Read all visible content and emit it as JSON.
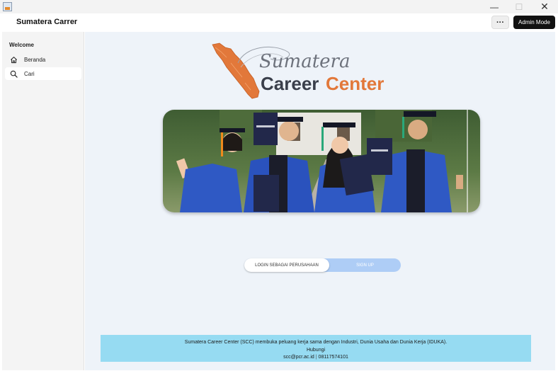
{
  "window": {
    "minimize_glyph": "—",
    "maximize_glyph": "☐",
    "close_glyph": "✕"
  },
  "header": {
    "title": "Sumatera Carrer",
    "more_label": "···",
    "admin_label": "Admin Mode"
  },
  "sidebar": {
    "heading": "Welcome",
    "items": [
      {
        "label": "Beranda",
        "icon": "home-icon",
        "active": false
      },
      {
        "label": "Cari",
        "icon": "search-icon",
        "active": true
      }
    ]
  },
  "logo": {
    "script_text": "Sumatera",
    "word_career": "Career",
    "word_center": "Center",
    "career_color": "#3a3f4b",
    "center_color": "#e2783a",
    "map_color": "#e2783a"
  },
  "auth_toggle": {
    "login_label": "LOGIN SEBAGAI PERUSAHAAN",
    "signup_label": "SIGN UP",
    "selected": "login"
  },
  "footer": {
    "description": "Sumatera Career Center (SCC) membuka peluang kerja sama dengan Industri, Dunia Usaha dan Dunia Kerja (IDUKA).",
    "contact_heading": "Hubungi",
    "email": "scc@pcr.ac.id",
    "separator": "|",
    "phone": "08117574101",
    "background": "#96dbf2"
  },
  "colors": {
    "main_background": "#eef3f9",
    "accent_dark": "#111111",
    "toggle_track": "#aecdf6"
  }
}
